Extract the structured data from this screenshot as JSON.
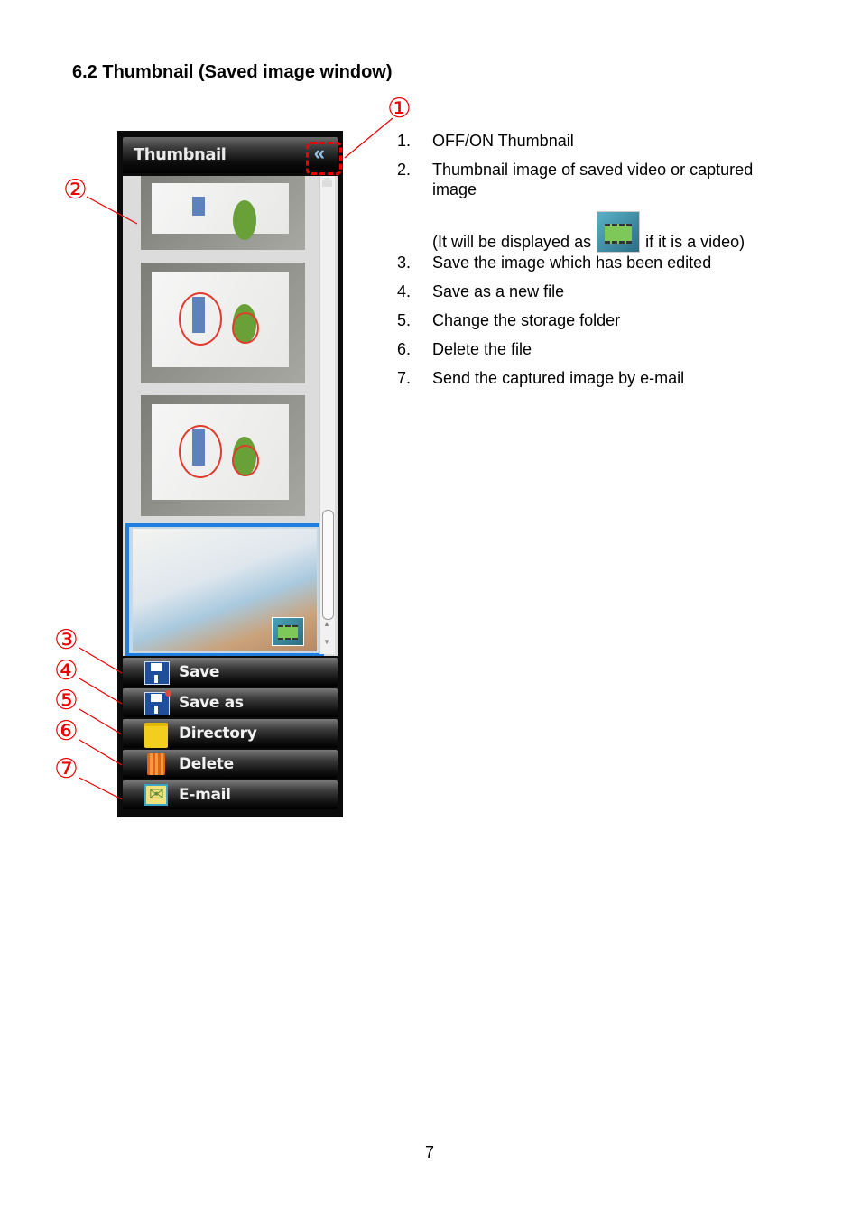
{
  "heading": "6.2  Thumbnail (Saved image window)",
  "panel": {
    "title": "Thumbnail",
    "toggle_icon": "double-chevron-left-icon",
    "toggle_glyph": "«",
    "thumbnails": [
      {
        "type": "image",
        "annotated": false
      },
      {
        "type": "image",
        "annotated": true
      },
      {
        "type": "image",
        "annotated": true
      },
      {
        "type": "video",
        "selected": true
      }
    ],
    "scroll_up_glyph": "▲",
    "scroll_down_glyph": "▼",
    "menu": [
      {
        "label": "Save",
        "icon": "floppy-disk-icon"
      },
      {
        "label": "Save as",
        "icon": "floppy-disk-new-icon"
      },
      {
        "label": "Directory",
        "icon": "folder-icon"
      },
      {
        "label": "Delete",
        "icon": "trash-icon"
      },
      {
        "label": "E-mail",
        "icon": "envelope-icon"
      }
    ]
  },
  "markers": [
    "①",
    "②",
    "③",
    "④",
    "⑤",
    "⑥",
    "⑦"
  ],
  "descriptions": [
    {
      "num": "1.",
      "text": "OFF/ON Thumbnail"
    },
    {
      "num": "2.",
      "text": "Thumbnail image of saved video or captured",
      "text2": "image",
      "note_before": "(It will be displayed as",
      "note_after": "if it is a video)"
    },
    {
      "num": "3.",
      "text": "Save the image which has been edited"
    },
    {
      "num": "4.",
      "text": "Save as a new file"
    },
    {
      "num": "5.",
      "text": "Change the storage folder"
    },
    {
      "num": "6.",
      "text": "Delete the file"
    },
    {
      "num": "7.",
      "text": "Send the captured image by e-mail"
    }
  ],
  "page_number": "7",
  "colors": {
    "annotation": "#ee0000",
    "selection": "#1f7fe0",
    "toggle": "#8fc3e8"
  }
}
